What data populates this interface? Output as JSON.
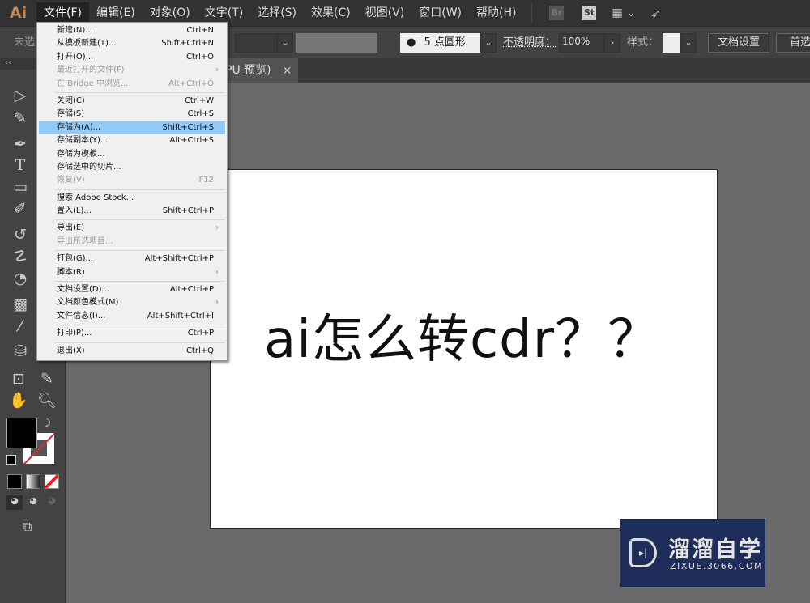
{
  "app": {
    "logo": "Ai"
  },
  "menubar": [
    "文件(F)",
    "编辑(E)",
    "对象(O)",
    "文字(T)",
    "选择(S)",
    "效果(C)",
    "视图(V)",
    "窗口(W)",
    "帮助(H)"
  ],
  "menubar_icons": {
    "bridge": "Br",
    "stock": "St"
  },
  "control": {
    "selection": "未选",
    "brush": "5 点圆形",
    "opacity_label": "不透明度：",
    "opacity": "100%",
    "style_label": "样式：",
    "doc_setup": "文档设置",
    "prefs": "首选"
  },
  "tab": {
    "title": "PU 预览)",
    "close": "×"
  },
  "file_menu": [
    [
      {
        "label": "新建(N)...",
        "sc": "Ctrl+N"
      },
      {
        "label": "从模板新建(T)...",
        "sc": "Shift+Ctrl+N"
      },
      {
        "label": "打开(O)...",
        "sc": "Ctrl+O"
      },
      {
        "label": "最近打开的文件(F)",
        "sub": true,
        "dis": true
      },
      {
        "label": "在 Bridge 中浏览...",
        "sc": "Alt+Ctrl+O",
        "dis": true
      }
    ],
    [
      {
        "label": "关闭(C)",
        "sc": "Ctrl+W"
      },
      {
        "label": "存储(S)",
        "sc": "Ctrl+S"
      },
      {
        "label": "存储为(A)...",
        "sc": "Shift+Ctrl+S",
        "hl": true
      },
      {
        "label": "存储副本(Y)...",
        "sc": "Alt+Ctrl+S"
      },
      {
        "label": "存储为模板..."
      },
      {
        "label": "存储选中的切片..."
      },
      {
        "label": "恢复(V)",
        "sc": "F12",
        "dis": true
      }
    ],
    [
      {
        "label": "搜索 Adobe Stock..."
      },
      {
        "label": "置入(L)...",
        "sc": "Shift+Ctrl+P"
      }
    ],
    [
      {
        "label": "导出(E)",
        "sub": true
      },
      {
        "label": "导出所选项目...",
        "dis": true
      }
    ],
    [
      {
        "label": "打包(G)...",
        "sc": "Alt+Shift+Ctrl+P"
      },
      {
        "label": "脚本(R)",
        "sub": true
      }
    ],
    [
      {
        "label": "文档设置(D)...",
        "sc": "Alt+Ctrl+P"
      },
      {
        "label": "文档颜色模式(M)",
        "sub": true
      },
      {
        "label": "文件信息(I)...",
        "sc": "Alt+Shift+Ctrl+I"
      }
    ],
    [
      {
        "label": "打印(P)...",
        "sc": "Ctrl+P"
      }
    ],
    [
      {
        "label": "退出(X)",
        "sc": "Ctrl+Q"
      }
    ]
  ],
  "artboard": {
    "text": "ai怎么转cdr？？"
  },
  "watermark": {
    "title": "溜溜自学",
    "url": "ZIXUE.3066.COM"
  },
  "colors": {
    "highlight": "#91c9f7",
    "watermark_bg": "#1f2d5a",
    "fill": "#000000",
    "stroke": "none"
  }
}
